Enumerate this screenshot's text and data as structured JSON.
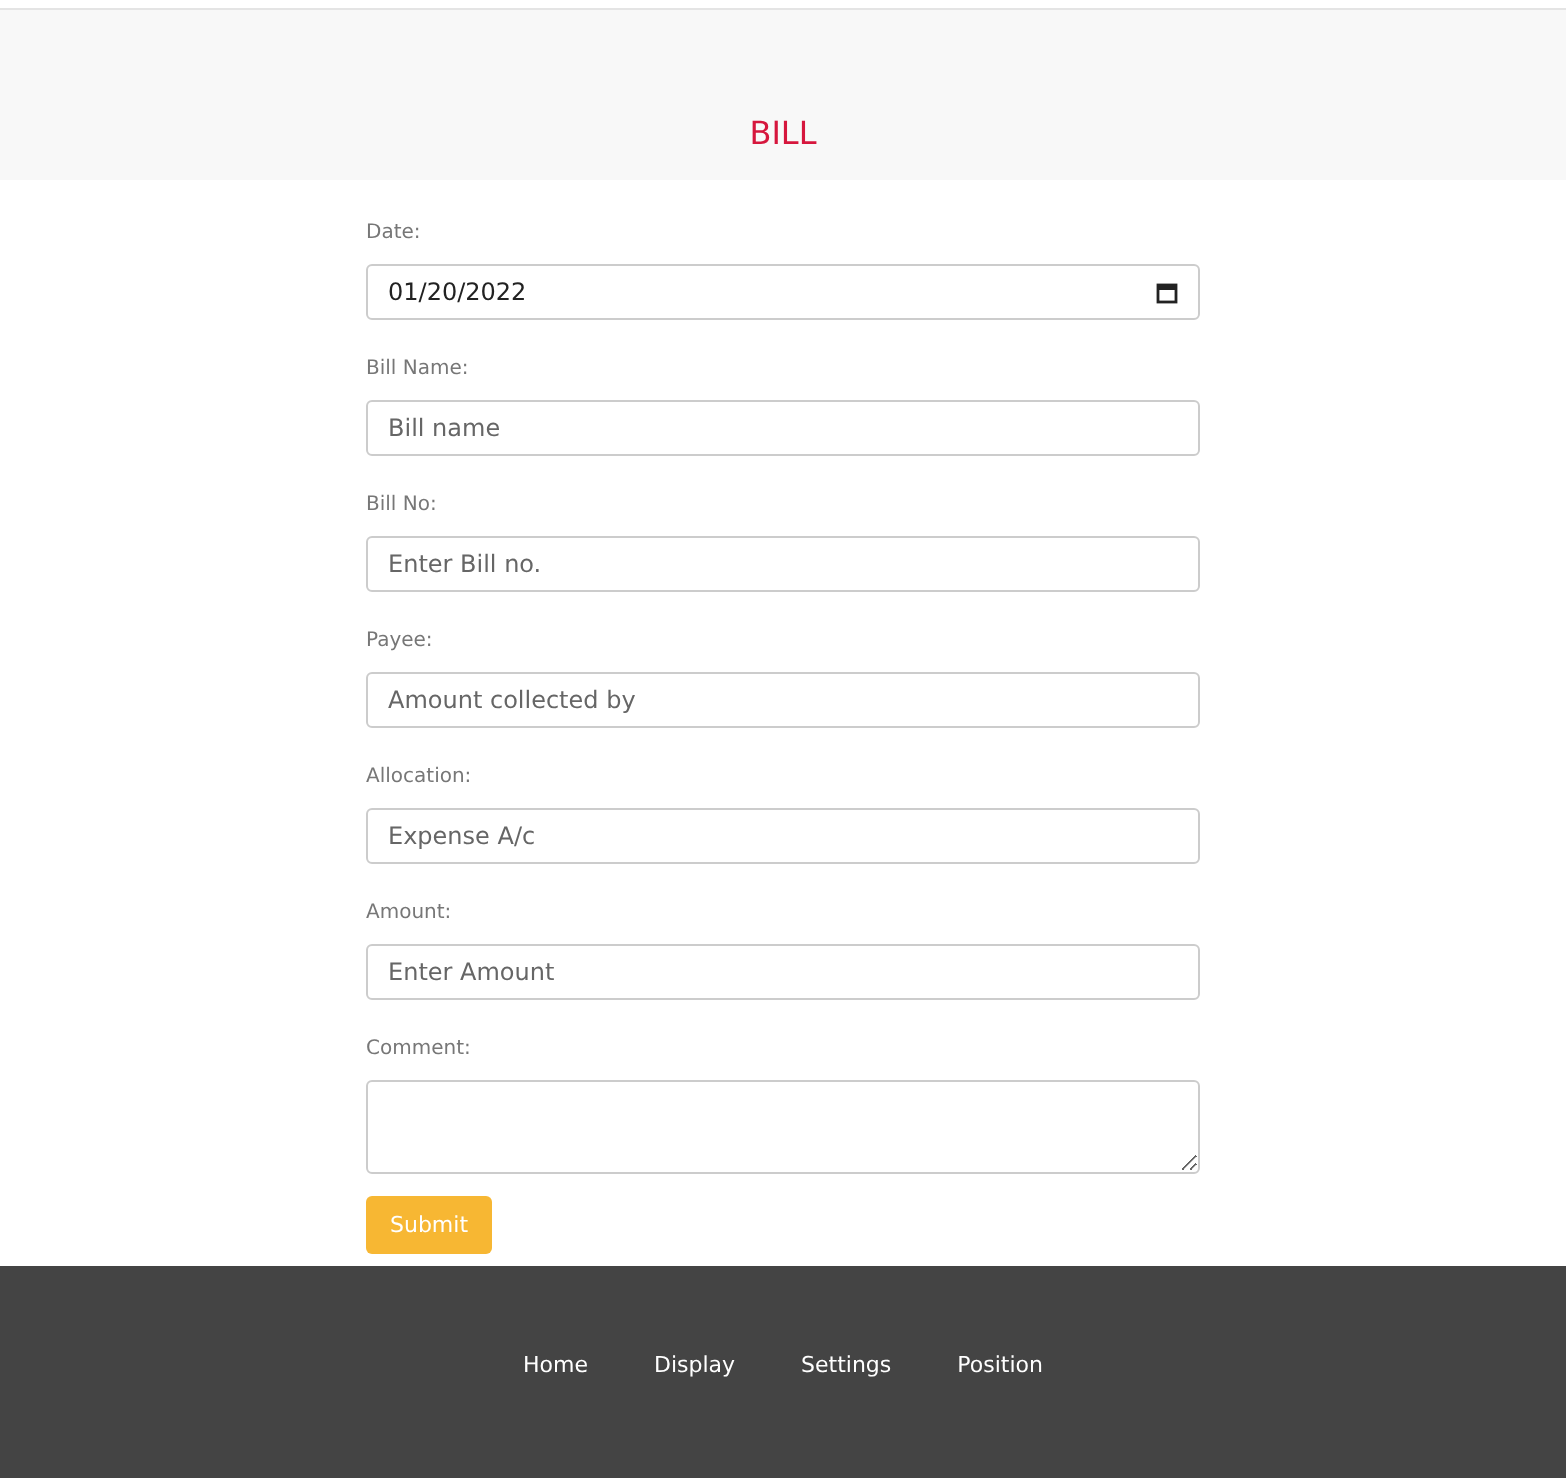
{
  "header": {
    "title": "BILL"
  },
  "form": {
    "fields": [
      {
        "kind": "date",
        "label": "Date:",
        "value": "01/20/2022"
      },
      {
        "kind": "text",
        "label": "Bill Name:",
        "placeholder": "Bill name"
      },
      {
        "kind": "text",
        "label": "Bill No:",
        "placeholder": "Enter Bill no."
      },
      {
        "kind": "text",
        "label": "Payee:",
        "placeholder": "Amount collected by"
      },
      {
        "kind": "text",
        "label": "Allocation:",
        "placeholder": "Expense A/c"
      },
      {
        "kind": "text",
        "label": "Amount:",
        "placeholder": "Enter Amount"
      },
      {
        "kind": "textarea",
        "label": "Comment:"
      }
    ],
    "submit": "Submit"
  },
  "footer": {
    "links": [
      "Home",
      "Display",
      "Settings",
      "Position"
    ]
  }
}
